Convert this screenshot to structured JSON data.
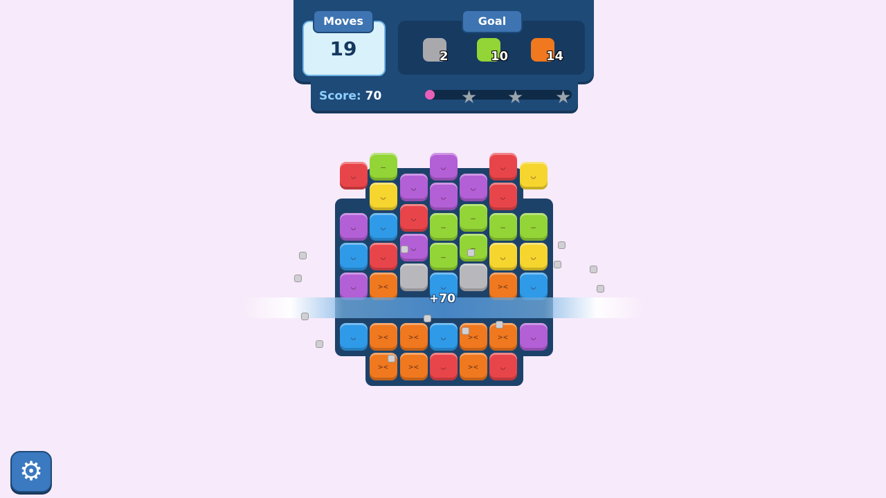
{
  "hud": {
    "moves_label": "Moves",
    "moves_value": "19",
    "goal_label": "Goal",
    "goals": [
      {
        "name": "stone-block",
        "count": "2",
        "color": "#a9a9ad"
      },
      {
        "name": "green-block",
        "count": "10",
        "color": "#93d436"
      },
      {
        "name": "orange-block",
        "count": "14",
        "color": "#f0781e"
      }
    ],
    "score_label": "Score:",
    "score_value": "70",
    "progress": 0.06
  },
  "popup_score": "+70",
  "colors": {
    "red": "#e8454a",
    "green": "#93d436",
    "purple": "#b35fd6",
    "yellow": "#f5d52e",
    "blue": "#2f9ae8",
    "orange": "#f0781e",
    "stone": "#b8b8bc"
  },
  "settings_icon": "gear-icon"
}
